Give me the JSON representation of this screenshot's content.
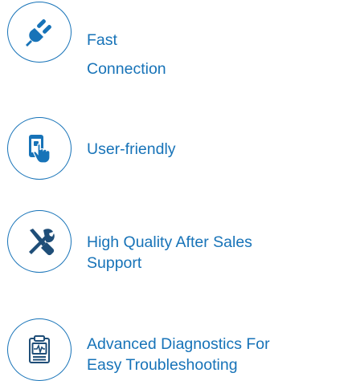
{
  "colors": {
    "accent": "#1773b8",
    "background": "#ffffff"
  },
  "features": [
    {
      "icon": "plug-icon",
      "lines": [
        "Fast",
        "Connection"
      ]
    },
    {
      "icon": "touch-device-icon",
      "lines": [
        "User-friendly"
      ]
    },
    {
      "icon": "tools-icon",
      "lines": [
        "High Quality After Sales",
        "Support"
      ]
    },
    {
      "icon": "clipboard-diagnostics-icon",
      "lines": [
        "Advanced Diagnostics For",
        "Easy Troubleshooting"
      ]
    }
  ]
}
